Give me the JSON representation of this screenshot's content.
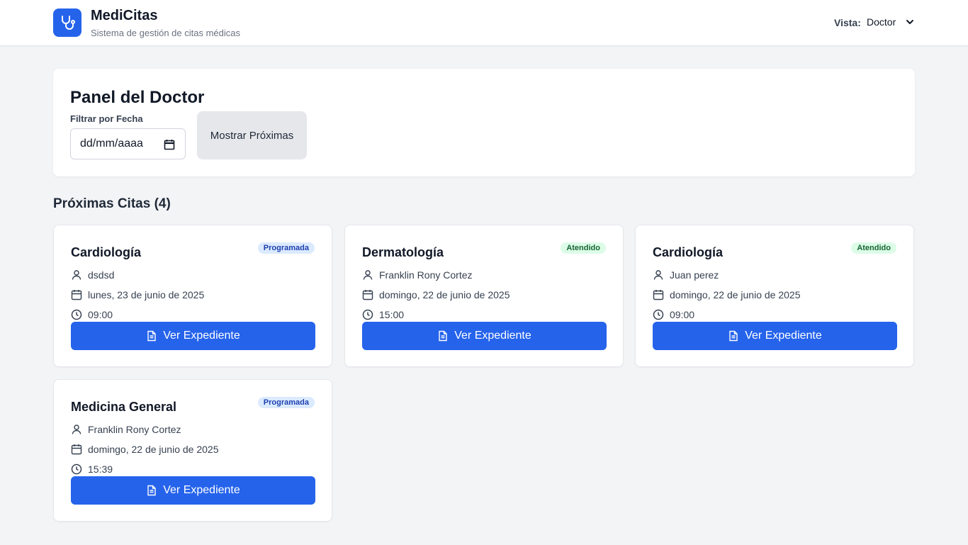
{
  "header": {
    "app_name": "MediCitas",
    "subtitle": "Sistema de gestión de citas médicas",
    "vista_label": "Vista:",
    "vista_value": "Doctor"
  },
  "panel": {
    "title": "Panel del Doctor",
    "filter_label": "Filtrar por Fecha",
    "date_placeholder": "dd/mm/aaaa",
    "show_button": "Mostrar Próximas"
  },
  "section": {
    "title": "Próximas Citas (4)"
  },
  "appointments": [
    {
      "specialty": "Cardiología",
      "status": "Programada",
      "patient": "dsdsd",
      "date": "lunes, 23 de junio de 2025",
      "time": "09:00",
      "button": "Ver Expediente"
    },
    {
      "specialty": "Dermatología",
      "status": "Atendido",
      "patient": "Franklin Rony Cortez",
      "date": "domingo, 22 de junio de 2025",
      "time": "15:00",
      "button": "Ver Expediente"
    },
    {
      "specialty": "Cardiología",
      "status": "Atendido",
      "patient": "Juan perez",
      "date": "domingo, 22 de junio de 2025",
      "time": "09:00",
      "button": "Ver Expediente"
    },
    {
      "specialty": "Medicina General",
      "status": "Programada",
      "patient": "Franklin Rony Cortez",
      "date": "domingo, 22 de junio de 2025",
      "time": "15:39",
      "button": "Ver Expediente"
    }
  ],
  "colors": {
    "primary": "#2563eb",
    "badge_programada_bg": "#dbeafe",
    "badge_programada_text": "#1e40af",
    "badge_atendido_bg": "#dcfce7",
    "badge_atendido_text": "#166534"
  }
}
